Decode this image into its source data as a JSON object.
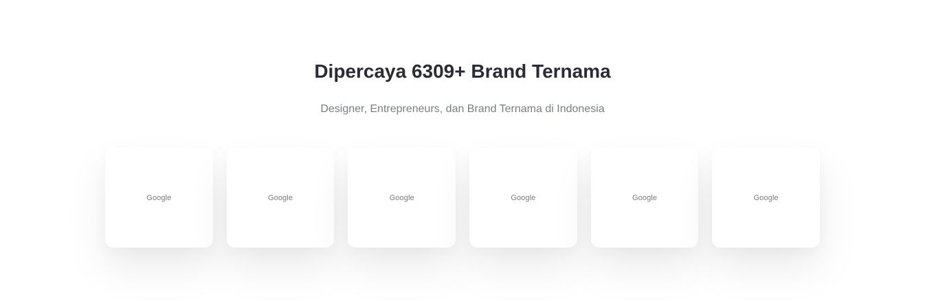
{
  "section": {
    "title": "Dipercaya 6309+ Brand Ternama",
    "subtitle": "Designer, Entrepreneurs, dan Brand Ternama di Indonesia"
  },
  "logos": [
    {
      "name": "Google"
    },
    {
      "name": "Google"
    },
    {
      "name": "Google"
    },
    {
      "name": "Google"
    },
    {
      "name": "Google"
    },
    {
      "name": "Google"
    }
  ]
}
